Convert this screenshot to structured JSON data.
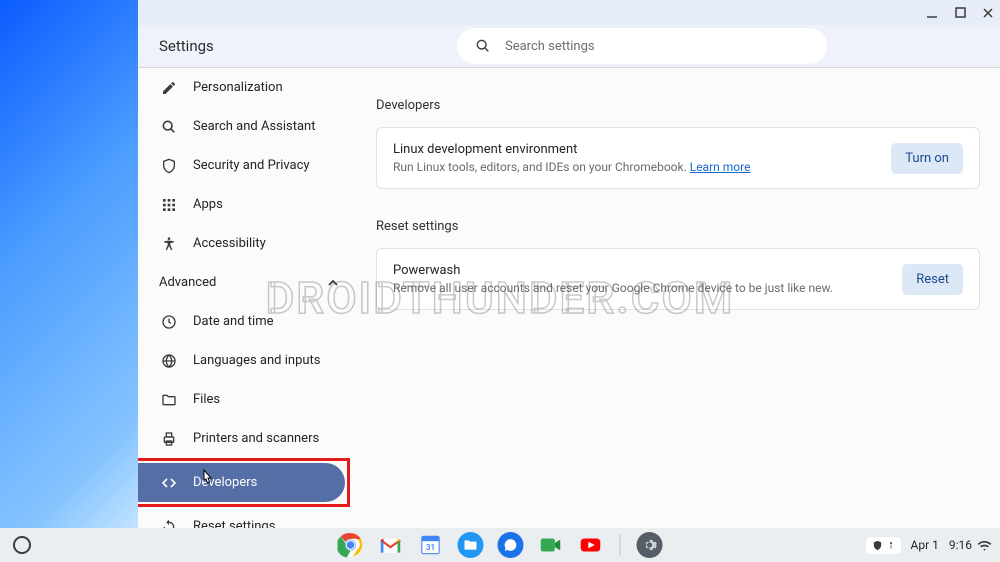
{
  "window": {
    "title": "Settings",
    "search_placeholder": "Search settings"
  },
  "sidebar": {
    "items": [
      {
        "id": "personalization",
        "label": "Personalization"
      },
      {
        "id": "search-assistant",
        "label": "Search and Assistant"
      },
      {
        "id": "security-privacy",
        "label": "Security and Privacy"
      },
      {
        "id": "apps",
        "label": "Apps"
      },
      {
        "id": "accessibility",
        "label": "Accessibility"
      }
    ],
    "section_label": "Advanced",
    "advanced_items": [
      {
        "id": "date-time",
        "label": "Date and time"
      },
      {
        "id": "languages-inputs",
        "label": "Languages and inputs"
      },
      {
        "id": "files",
        "label": "Files"
      },
      {
        "id": "printers-scanners",
        "label": "Printers and scanners"
      },
      {
        "id": "developers",
        "label": "Developers"
      },
      {
        "id": "reset-settings",
        "label": "Reset settings"
      }
    ]
  },
  "content": {
    "developers": {
      "heading": "Developers",
      "card_title": "Linux development environment",
      "card_desc": "Run Linux tools, editors, and IDEs on your Chromebook. ",
      "learn_more": "Learn more",
      "button": "Turn on"
    },
    "reset": {
      "heading": "Reset settings",
      "card_title": "Powerwash",
      "card_desc": "Remove all user accounts and reset your Google Chrome device to be just like new.",
      "button": "Reset"
    }
  },
  "shelf": {
    "date": "Apr 1",
    "time": "9:16"
  },
  "watermark": "DROIDTHUNDER.COM",
  "colors": {
    "accent": "#556fa6",
    "highlight": "#e21b1b",
    "button_bg": "#dce8f6",
    "button_fg": "#1a4b8d"
  }
}
